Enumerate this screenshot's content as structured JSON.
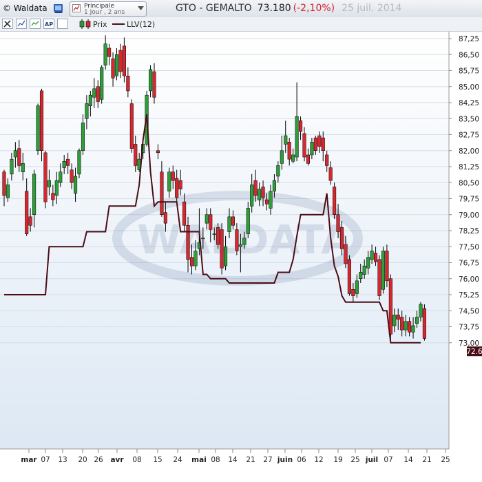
{
  "app": {
    "brand": "© Waldata"
  },
  "selector": {
    "line1": "Principale",
    "line2": "1 Jour , 2 ans"
  },
  "header": {
    "symbol": "GTO - GEMALTO",
    "price": "73.180",
    "change": "(-2,10%)",
    "date": "25 juil. 2014"
  },
  "legend": {
    "prix": "Prix",
    "llv": "LLV(12)"
  },
  "toolbar": {
    "icons": [
      "tools-icon",
      "chart-type-icon",
      "chart-type-2-icon",
      "ap-icon",
      "square-icon"
    ]
  },
  "colors": {
    "up": "#2f9e3a",
    "down": "#d8282f",
    "llv": "#4a0d16",
    "change": "#d2242a"
  },
  "chart_data": {
    "type": "candlestick",
    "title": "GTO - GEMALTO",
    "ylim": [
      72.6,
      87.6
    ],
    "y_ticks": [
      "87,25",
      "86,50",
      "85,75",
      "85,00",
      "84,25",
      "83,50",
      "82,75",
      "82,00",
      "81,25",
      "80,50",
      "79,75",
      "79,00",
      "78,25",
      "77,50",
      "76,75",
      "76,00",
      "75,25",
      "74,50",
      "73,75",
      "73,00"
    ],
    "x_ticks": [
      "mar",
      "07",
      "13",
      "20",
      "26",
      "avr",
      "08",
      "15",
      "24",
      "mai",
      "08",
      "14",
      "21",
      "27",
      "juin",
      "06",
      "12",
      "19",
      "25",
      "juil",
      "07",
      "14",
      "21",
      "25"
    ],
    "last_value_label": "72.6",
    "watermark": "WALDATA",
    "candles": [
      [
        81.0,
        79.9,
        81.1,
        79.4
      ],
      [
        79.8,
        80.4,
        80.7,
        79.6
      ],
      [
        80.9,
        81.6,
        81.9,
        80.6
      ],
      [
        81.7,
        82.0,
        82.4,
        81.2
      ],
      [
        82.1,
        81.3,
        82.5,
        81.0
      ],
      [
        81.0,
        81.4,
        81.9,
        80.6
      ],
      [
        80.1,
        78.1,
        80.7,
        78.0
      ],
      [
        78.9,
        78.5,
        79.3,
        78.2
      ],
      [
        79.0,
        80.9,
        81.1,
        78.4
      ],
      [
        82.0,
        84.1,
        84.2,
        81.8
      ],
      [
        84.8,
        82.0,
        84.9,
        81.5
      ],
      [
        81.9,
        79.6,
        82.0,
        79.3
      ],
      [
        80.3,
        80.6,
        81.1,
        79.9
      ],
      [
        80.0,
        79.7,
        80.4,
        79.4
      ],
      [
        79.9,
        80.6,
        81.0,
        79.5
      ],
      [
        80.5,
        81.0,
        81.4,
        80.3
      ],
      [
        81.2,
        81.5,
        81.8,
        80.9
      ],
      [
        81.6,
        81.3,
        81.9,
        80.9
      ],
      [
        81.1,
        80.5,
        81.4,
        80.2
      ],
      [
        80.0,
        80.8,
        81.2,
        79.6
      ],
      [
        80.9,
        82.0,
        82.1,
        80.7
      ],
      [
        82.0,
        83.3,
        83.7,
        81.8
      ],
      [
        83.5,
        84.2,
        84.6,
        83.0
      ],
      [
        84.1,
        84.6,
        84.8,
        83.6
      ],
      [
        84.5,
        84.9,
        85.4,
        84.0
      ],
      [
        85.0,
        84.3,
        85.3,
        84.0
      ],
      [
        84.4,
        85.9,
        86.0,
        84.2
      ],
      [
        86.0,
        87.0,
        87.4,
        85.8
      ],
      [
        86.8,
        86.4,
        87.0,
        86.0
      ],
      [
        86.3,
        85.4,
        86.6,
        85.0
      ],
      [
        85.5,
        86.5,
        86.8,
        85.3
      ],
      [
        86.7,
        85.7,
        87.0,
        85.4
      ],
      [
        86.9,
        85.5,
        87.3,
        85.2
      ],
      [
        85.5,
        84.8,
        85.9,
        84.5
      ],
      [
        84.2,
        82.1,
        84.4,
        81.9
      ],
      [
        82.3,
        81.3,
        82.7,
        81.0
      ],
      [
        81.1,
        81.6,
        81.9,
        81.0
      ],
      [
        81.9,
        82.3,
        82.6,
        81.6
      ],
      [
        82.3,
        84.6,
        84.8,
        82.2
      ],
      [
        84.8,
        85.8,
        86.0,
        84.5
      ],
      [
        85.7,
        84.5,
        86.1,
        84.2
      ],
      [
        82.0,
        81.9,
        82.3,
        81.6
      ],
      [
        81.0,
        79.0,
        81.5,
        78.9
      ],
      [
        79.1,
        78.6,
        79.6,
        78.2
      ],
      [
        80.1,
        81.0,
        81.2,
        79.8
      ],
      [
        81.0,
        80.6,
        81.3,
        80.2
      ],
      [
        80.7,
        79.8,
        81.1,
        79.6
      ],
      [
        80.6,
        80.2,
        81.1,
        79.9
      ],
      [
        79.6,
        78.5,
        80.0,
        78.2
      ],
      [
        78.5,
        76.9,
        78.9,
        76.3
      ],
      [
        77.0,
        76.6,
        77.6,
        76.2
      ],
      [
        76.6,
        77.3,
        77.8,
        76.4
      ],
      [
        77.4,
        77.7,
        79.3,
        77.1
      ],
      [
        77.9,
        77.9,
        78.4,
        77.4
      ],
      [
        78.6,
        79.0,
        79.3,
        78.3
      ],
      [
        79.0,
        78.3,
        79.3,
        77.7
      ],
      [
        78.1,
        78.1,
        78.4,
        77.8
      ],
      [
        78.4,
        77.6,
        78.6,
        77.4
      ],
      [
        78.3,
        76.5,
        78.6,
        76.2
      ],
      [
        76.6,
        77.5,
        78.0,
        76.4
      ],
      [
        78.2,
        78.9,
        79.3,
        77.9
      ],
      [
        78.9,
        78.5,
        79.2,
        78.3
      ],
      [
        78.3,
        77.3,
        78.6,
        77.1
      ],
      [
        77.5,
        77.6,
        78.1,
        76.3
      ],
      [
        77.6,
        77.9,
        78.2,
        77.4
      ],
      [
        78.1,
        79.3,
        79.6,
        77.9
      ],
      [
        79.4,
        80.4,
        80.9,
        79.1
      ],
      [
        80.6,
        79.9,
        81.1,
        79.6
      ],
      [
        79.7,
        80.2,
        80.5,
        79.4
      ],
      [
        80.3,
        79.8,
        80.6,
        79.4
      ],
      [
        79.7,
        79.5,
        80.0,
        79.2
      ],
      [
        79.3,
        80.1,
        80.4,
        79.0
      ],
      [
        80.1,
        80.6,
        80.9,
        79.8
      ],
      [
        80.8,
        81.3,
        81.5,
        80.5
      ],
      [
        81.4,
        82.0,
        82.7,
        81.1
      ],
      [
        82.3,
        82.7,
        83.4,
        81.9
      ],
      [
        82.4,
        81.6,
        82.6,
        81.3
      ],
      [
        81.5,
        81.8,
        82.1,
        81.4
      ],
      [
        81.7,
        83.6,
        85.2,
        81.5
      ],
      [
        83.4,
        82.9,
        83.6,
        82.5
      ],
      [
        82.8,
        81.7,
        83.1,
        81.5
      ],
      [
        81.8,
        81.4,
        82.1,
        81.3
      ],
      [
        81.8,
        82.4,
        82.6,
        81.6
      ],
      [
        82.6,
        82.0,
        82.7,
        81.8
      ],
      [
        82.7,
        82.2,
        82.9,
        81.9
      ],
      [
        82.6,
        82.0,
        82.9,
        81.5
      ],
      [
        81.8,
        81.3,
        82.0,
        81.0
      ],
      [
        81.2,
        80.6,
        81.5,
        80.4
      ],
      [
        80.3,
        79.0,
        80.5,
        78.8
      ],
      [
        79.0,
        78.2,
        79.5,
        77.9
      ],
      [
        78.4,
        77.4,
        78.7,
        77.1
      ],
      [
        77.6,
        76.7,
        78.0,
        76.5
      ],
      [
        76.9,
        75.3,
        77.1,
        75.2
      ],
      [
        75.5,
        75.2,
        75.8,
        74.9
      ],
      [
        75.3,
        75.9,
        76.2,
        75.1
      ],
      [
        76.0,
        76.3,
        76.7,
        75.8
      ],
      [
        76.2,
        76.6,
        76.9,
        76.0
      ],
      [
        76.5,
        77.0,
        77.3,
        76.2
      ],
      [
        76.9,
        77.3,
        77.6,
        76.7
      ],
      [
        77.2,
        76.8,
        77.5,
        76.6
      ],
      [
        76.9,
        75.2,
        77.1,
        75.0
      ],
      [
        75.5,
        77.3,
        77.5,
        75.3
      ],
      [
        77.3,
        75.9,
        77.6,
        75.6
      ],
      [
        76.0,
        73.4,
        76.2,
        73.0
      ],
      [
        73.8,
        74.3,
        74.6,
        73.5
      ],
      [
        74.3,
        74.1,
        74.6,
        73.6
      ],
      [
        74.2,
        73.6,
        74.5,
        73.3
      ],
      [
        73.6,
        74.0,
        74.3,
        73.3
      ],
      [
        74.0,
        73.5,
        74.2,
        73.3
      ],
      [
        73.5,
        73.8,
        74.2,
        73.2
      ],
      [
        73.9,
        74.2,
        74.5,
        73.7
      ],
      [
        74.2,
        74.8,
        74.9,
        74.0
      ],
      [
        74.6,
        73.2,
        74.8,
        73.1
      ]
    ],
    "llv": [
      75.25,
      75.25,
      75.25,
      75.25,
      75.25,
      75.25,
      75.25,
      75.25,
      75.25,
      75.25,
      75.25,
      75.25,
      77.5,
      77.5,
      77.5,
      77.5,
      77.5,
      77.5,
      77.5,
      77.5,
      77.5,
      77.5,
      78.2,
      78.2,
      78.2,
      78.2,
      78.2,
      78.2,
      79.4,
      79.4,
      79.4,
      79.4,
      79.4,
      79.4,
      79.4,
      79.4,
      80.4,
      82.5,
      83.7,
      81.0,
      79.4,
      79.6,
      79.6,
      79.6,
      79.6,
      79.6,
      79.6,
      78.2,
      78.2,
      78.2,
      78.2,
      78.2,
      78.2,
      76.2,
      76.2,
      76.0,
      76.0,
      76.0,
      76.0,
      76.0,
      75.8,
      75.8,
      75.8,
      75.8,
      75.8,
      75.8,
      75.8,
      75.8,
      75.8,
      75.8,
      75.8,
      75.8,
      75.8,
      76.3,
      76.3,
      76.3,
      76.3,
      76.9,
      78.0,
      79.0,
      79.0,
      79.0,
      79.0,
      79.0,
      79.0,
      79.0,
      80.0,
      77.9,
      76.6,
      76.1,
      75.2,
      74.9,
      74.9,
      74.9,
      74.9,
      74.9,
      74.9,
      74.9,
      74.9,
      74.9,
      74.9,
      74.5,
      74.5,
      73.0,
      73.0,
      73.0,
      73.0,
      73.0,
      73.0,
      73.0,
      73.0,
      73.0
    ]
  }
}
